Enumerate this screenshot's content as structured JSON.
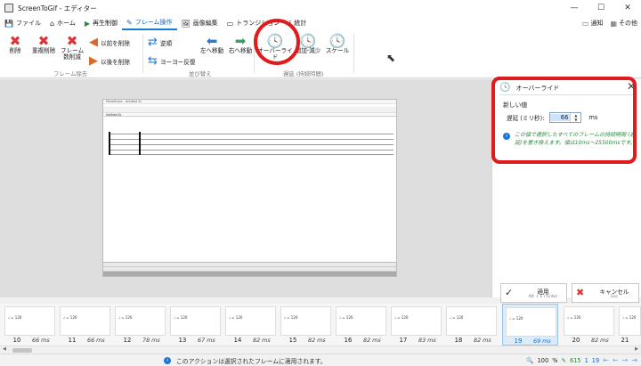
{
  "window": {
    "title": "ScreenToGif - エディター",
    "minimize": "—",
    "maximize": "☐",
    "close": "✕"
  },
  "tabs": [
    {
      "label": "ファイル",
      "icon": "💾"
    },
    {
      "label": "ホーム",
      "icon": "⌂"
    },
    {
      "label": "再生制御",
      "icon": "▶"
    },
    {
      "label": "フレーム操作",
      "icon": "✎"
    },
    {
      "label": "画像編集",
      "icon": "🖼"
    },
    {
      "label": "トランジション",
      "icon": "▭"
    },
    {
      "label": "統計",
      "icon": "ℹ"
    }
  ],
  "tabs_right": {
    "notify": "通知",
    "other": "その他"
  },
  "ribbon": {
    "remove": {
      "delete": "削除",
      "delete_dup": "重複削除",
      "reduce": "フレーム数削減",
      "delete_prev": "以前を削除",
      "delete_next": "以後を削除",
      "group": "フレーム除去"
    },
    "reorder": {
      "reverse": "逆順",
      "yoyo": "ヨーヨー反復",
      "move_left": "左へ移動",
      "move_right": "右へ移動",
      "group": "並び替え"
    },
    "delay": {
      "override": "オーバーライド",
      "increase": "増加-減少",
      "scale": "スケール",
      "group": "遅延 (持続時間)"
    }
  },
  "preview": {
    "app_title": "MuseScore - Untitled Sc",
    "tab": "Untitled Sc",
    "mini_tempo": "♩ = 120"
  },
  "panel": {
    "title": "オーバーライド",
    "section": "新しい値",
    "delay_label": "遅延 (ミリ秒):",
    "delay_value": "66",
    "unit": "ms",
    "info": "この値で選択したすべてのフレームの持続時間 (遅延)を置き換えます。値は10ms〜25500msです。"
  },
  "actions": {
    "apply": "適用",
    "apply_shortcut": "Alt + E / Enter",
    "cancel": "キャンセル",
    "cancel_shortcut": "Esc"
  },
  "frames": [
    {
      "num": "10",
      "ms": "66 ms"
    },
    {
      "num": "11",
      "ms": "66 ms"
    },
    {
      "num": "12",
      "ms": "78 ms"
    },
    {
      "num": "13",
      "ms": "67 ms"
    },
    {
      "num": "14",
      "ms": "82 ms"
    },
    {
      "num": "15",
      "ms": "82 ms"
    },
    {
      "num": "16",
      "ms": "82 ms"
    },
    {
      "num": "17",
      "ms": "83 ms"
    },
    {
      "num": "18",
      "ms": "82 ms"
    },
    {
      "num": "19",
      "ms": "69 ms"
    },
    {
      "num": "20",
      "ms": "82 ms"
    },
    {
      "num": "21",
      "ms": ""
    }
  ],
  "selected_frame_index": 9,
  "status": {
    "message": "このアクションは選択されたフレームに適用されます。",
    "zoom": "100",
    "zoom_unit": "%",
    "total_frames": "615",
    "selected_count": "1",
    "current_frame": "19"
  },
  "colors": {
    "highlight": "#e01b1b",
    "accent": "#1a7ad8",
    "info_text": "#2a8a3e"
  }
}
